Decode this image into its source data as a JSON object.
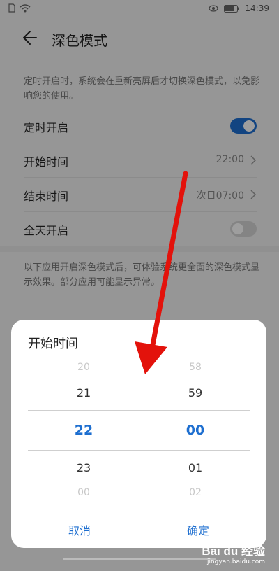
{
  "status_bar": {
    "time": "14:39"
  },
  "header": {
    "title": "深色模式"
  },
  "schedule_note": "定时开启时，系统会在重新亮屏后才切换深色模式，以免影响您的使用。",
  "settings": {
    "scheduled": {
      "label": "定时开启",
      "on": true
    },
    "start_time": {
      "label": "开始时间",
      "value": "22:00"
    },
    "end_time": {
      "label": "结束时间",
      "value": "次日07:00"
    },
    "all_day": {
      "label": "全天开启",
      "on": false
    }
  },
  "apps_note": "以下应用开启深色模式后，可体验系统更全面的深色模式显示效果。部分应用可能显示异常。",
  "picker": {
    "title": "开始时间",
    "hours": [
      "20",
      "21",
      "22",
      "23",
      "00"
    ],
    "minutes": [
      "58",
      "59",
      "00",
      "01",
      "02"
    ],
    "selected_hour": "22",
    "selected_minute": "00",
    "cancel_label": "取消",
    "confirm_label": "确定"
  },
  "colors": {
    "accent": "#1e6fd0",
    "arrow": "#e3120b"
  },
  "watermark": {
    "logo": "Bai du 经验",
    "sub": "jingyan.baidu.com"
  }
}
